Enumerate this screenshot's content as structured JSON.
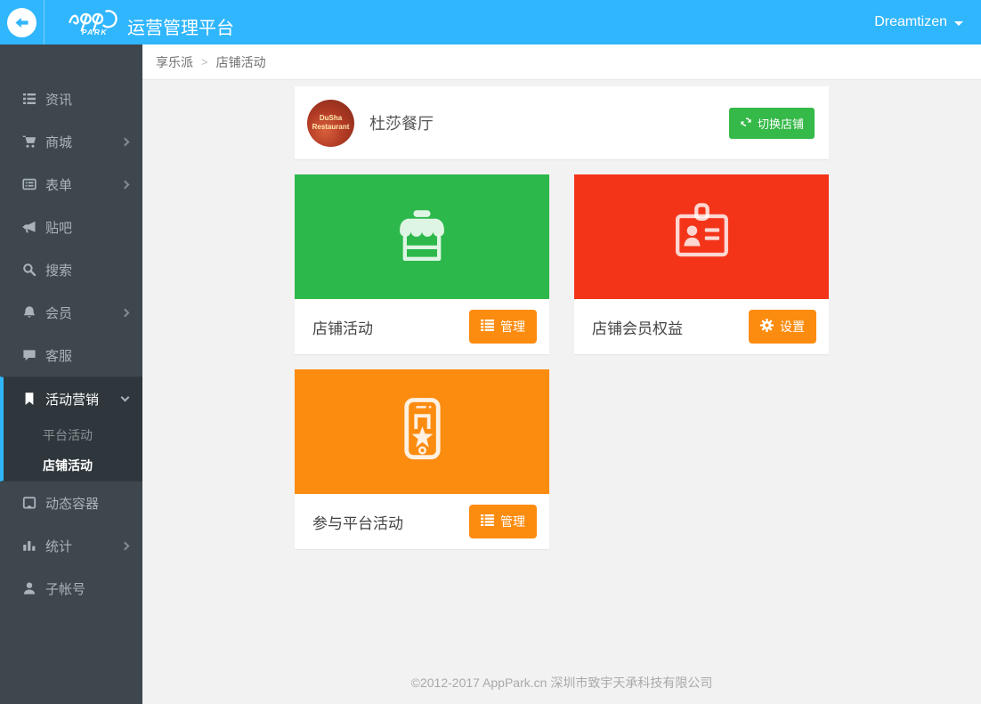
{
  "header": {
    "logo_text": "PARK",
    "brand_title": "运营管理平台",
    "user_menu": "Dreamtizen"
  },
  "breadcrumb": {
    "items": [
      "享乐派",
      "店铺活动"
    ],
    "separator": ">"
  },
  "sidebar": {
    "items": [
      {
        "label": "资讯",
        "icon": "list-icon",
        "has_submenu": false
      },
      {
        "label": "商城",
        "icon": "cart-icon",
        "has_submenu": true
      },
      {
        "label": "表单",
        "icon": "form-icon",
        "has_submenu": true
      },
      {
        "label": "贴吧",
        "icon": "bullhorn-icon",
        "has_submenu": false
      },
      {
        "label": "搜索",
        "icon": "search-icon",
        "has_submenu": false
      },
      {
        "label": "会员",
        "icon": "bell-icon",
        "has_submenu": true
      },
      {
        "label": "客服",
        "icon": "comment-icon",
        "has_submenu": false
      },
      {
        "label": "活动营销",
        "icon": "bookmark-icon",
        "has_submenu": true,
        "expanded": true,
        "active": true,
        "children": [
          "平台活动",
          "店铺活动"
        ],
        "active_child": "店铺活动"
      },
      {
        "label": "动态容器",
        "icon": "container-icon",
        "has_submenu": false
      },
      {
        "label": "统计",
        "icon": "chart-icon",
        "has_submenu": true
      },
      {
        "label": "子帐号",
        "icon": "user-icon",
        "has_submenu": false
      }
    ]
  },
  "store": {
    "name": "杜莎餐厅",
    "avatar_line1": "DuSha",
    "avatar_line2": "Restaurant",
    "switch_label": "切换店铺"
  },
  "cards": [
    {
      "title": "店铺活动",
      "action": "管理",
      "color": "#2db84b",
      "icon": "storefront-icon",
      "action_icon": "list-icon"
    },
    {
      "title": "店铺会员权益",
      "action": "设置",
      "color": "#f43419",
      "icon": "id-card-icon",
      "action_icon": "gear-icon"
    },
    {
      "title": "参与平台活动",
      "action": "管理",
      "color": "#fb8c10",
      "icon": "phone-star-icon",
      "action_icon": "list-icon"
    }
  ],
  "footer": {
    "copyright": "©2012-2017 AppPark.cn 深圳市致宇天承科技有限公司"
  },
  "colors": {
    "header_blue": "#30b6fc",
    "sidebar_bg": "#3e474d",
    "sidebar_active_bg": "#2f373c",
    "switch_green": "#35b948",
    "action_orange": "#fb8c10",
    "main_bg": "#f2f2f2"
  }
}
